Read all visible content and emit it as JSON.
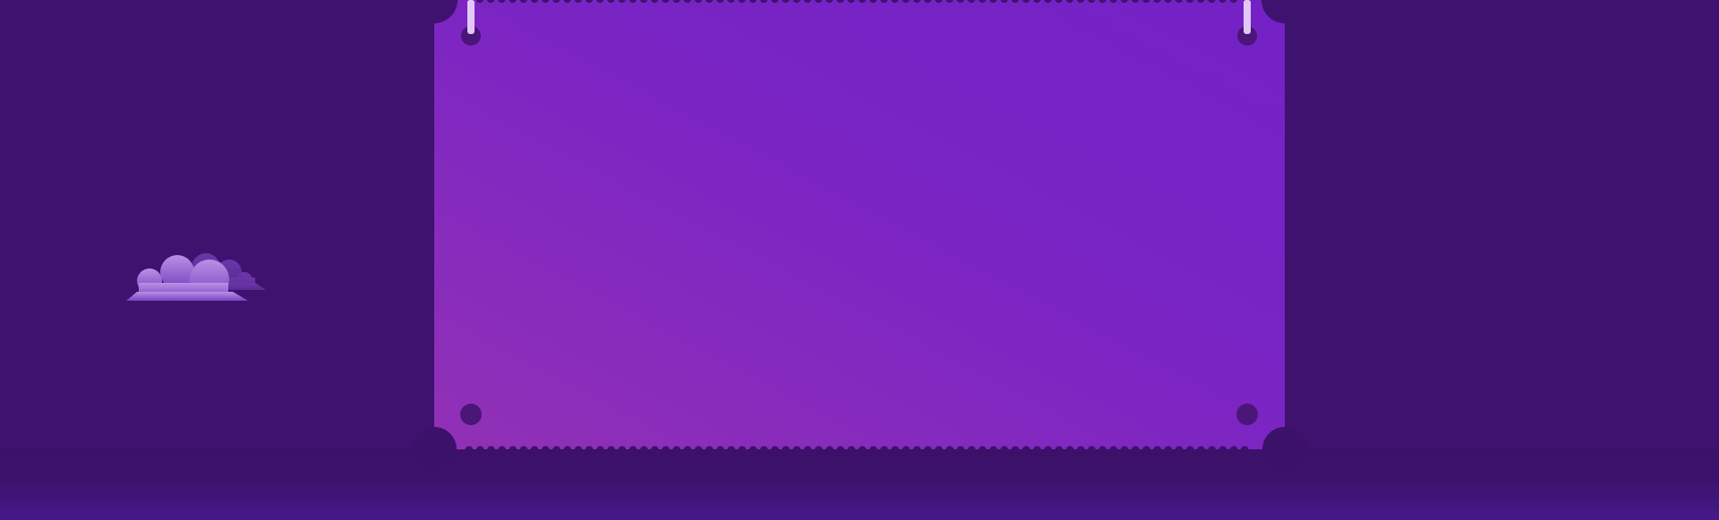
{
  "scene": {
    "title": "",
    "background_color": "#3f1270",
    "board": {
      "gradient_start": "#9231b6",
      "gradient_end": "#7322c6",
      "fastener_color": "#4a1677",
      "hanging_rod_color": "#d9b8f0",
      "scallop_color": "#3f1270"
    },
    "decorations": [
      "cloud-icon"
    ]
  }
}
